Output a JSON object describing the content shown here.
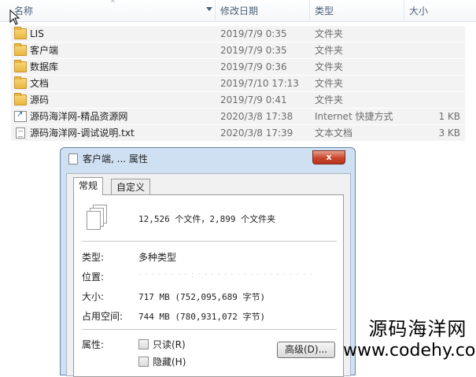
{
  "columns": {
    "name": "名称",
    "date": "修改日期",
    "type": "类型",
    "size": "大小"
  },
  "files": [
    {
      "name": "LIS",
      "date": "2019/7/9 0:35",
      "type": "文件夹",
      "size": "",
      "icon": "folder-icon"
    },
    {
      "name": "客户端",
      "date": "2019/7/9 0:35",
      "type": "文件夹",
      "size": "",
      "icon": "folder-icon"
    },
    {
      "name": "数据库",
      "date": "2019/7/9 0:36",
      "type": "文件夹",
      "size": "",
      "icon": "folder-icon"
    },
    {
      "name": "文档",
      "date": "2019/7/10 17:13",
      "type": "文件夹",
      "size": "",
      "icon": "folder-icon"
    },
    {
      "name": "源码",
      "date": "2019/7/9 0:41",
      "type": "文件夹",
      "size": "",
      "icon": "folder-icon"
    },
    {
      "name": "源码海洋网-精品资源网",
      "date": "2020/3/8 17:38",
      "type": "Internet 快捷方式",
      "size": "1 KB",
      "icon": "shortcut-icon"
    },
    {
      "name": "源码海洋网-调试说明.txt",
      "date": "2020/3/8 17:39",
      "type": "文本文档",
      "size": "3 KB",
      "icon": "text-file-icon"
    }
  ],
  "dialog": {
    "title": "客户端, ... 属性",
    "close": "x",
    "tabs": {
      "general": "常规",
      "custom": "自定义"
    },
    "summary": "12,526 个文件，2,899 个文件夹",
    "type_label": "类型:",
    "type_value": "多种类型",
    "location_label": "位置:",
    "location_value": "· · · · · · · · :  · · ·  · · · ·   · · · · · · · · · · ·",
    "size_label": "大小:",
    "size_value": "717 MB (752,095,689 字节)",
    "disk_label": "占用空间:",
    "disk_value": "744 MB (780,931,072 字节)",
    "attr_label": "属性:",
    "readonly": "只读(R)",
    "hidden": "隐藏(H)",
    "advanced": "高级(D)..."
  },
  "watermark": {
    "line1": "源码海洋网",
    "line2": "www.codehy.com"
  }
}
